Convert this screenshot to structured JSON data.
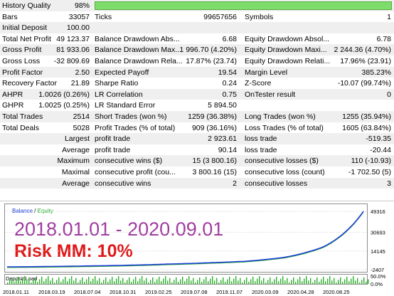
{
  "report": {
    "history_quality": {
      "label": "History Quality",
      "value": "98%",
      "fraction": 0.98
    },
    "rows3": [
      {
        "c1": "Bars",
        "v1": "33057",
        "c2": "Ticks",
        "v2": "99657656",
        "c3": "Symbols",
        "v3": "1"
      },
      {
        "c1": "Initial Deposit",
        "v1": "100.00",
        "c2": "",
        "v2": "",
        "c3": "",
        "v3": ""
      },
      {
        "c1": "Total Net Profit",
        "v1": "49 123.37",
        "c2": "Balance Drawdown Abs...",
        "v2": "6.68",
        "c3": "Equity Drawdown Absol...",
        "v3": "6.78"
      },
      {
        "c1": "Gross Profit",
        "v1": "81 933.06",
        "c2": "Balance Drawdown Max...",
        "v2": "1 996.70 (4.20%)",
        "c3": "Equity Drawdown Maxi...",
        "v3": "2 244.36 (4.70%)"
      },
      {
        "c1": "Gross Loss",
        "v1": "-32 809.69",
        "c2": "Balance Drawdown Rela...",
        "v2": "17.87% (23.74)",
        "c3": "Equity Drawdown Relati...",
        "v3": "17.96% (23.91)"
      },
      {
        "c1": "Profit Factor",
        "v1": "2.50",
        "c2": "Expected Payoff",
        "v2": "19.54",
        "c3": "Margin Level",
        "v3": "385.23%"
      },
      {
        "c1": "Recovery Factor",
        "v1": "21.89",
        "c2": "Sharpe Ratio",
        "v2": "0.24",
        "c3": "Z-Score",
        "v3": "-10.07 (99.74%)"
      },
      {
        "c1": "AHPR",
        "v1": "1.0026 (0.26%)",
        "c2": "LR Correlation",
        "v2": "0.75",
        "c3": "OnTester result",
        "v3": "0"
      },
      {
        "c1": "GHPR",
        "v1": "1.0025 (0.25%)",
        "c2": "LR Standard Error",
        "v2": "5 894.50",
        "c3": "",
        "v3": ""
      },
      {
        "c1": "Total Trades",
        "v1": "2514",
        "c2": "Short Trades (won %)",
        "v2": "1259 (36.38%)",
        "c3": "Long Trades (won %)",
        "v3": "1255 (35.94%)"
      },
      {
        "c1": "Total Deals",
        "v1": "5028",
        "c2": "Profit Trades (% of total)",
        "v2": "909 (36.16%)",
        "c3": "Loss Trades (% of total)",
        "v3": "1605 (63.84%)"
      }
    ],
    "rows_stats": [
      {
        "k": "Largest",
        "c2": "profit trade",
        "v2": "2 923.61",
        "c3": "loss trade",
        "v3": "-519.35"
      },
      {
        "k": "Average",
        "c2": "profit trade",
        "v2": "90.14",
        "c3": "loss trade",
        "v3": "-20.44"
      },
      {
        "k": "Maximum",
        "c2": "consecutive wins ($)",
        "v2": "15 (3 800.16)",
        "c3": "consecutive losses ($)",
        "v3": "110 (-10.93)"
      },
      {
        "k": "Maximal",
        "c2": "consecutive profit (cou...",
        "v2": "3 800.16 (15)",
        "c3": "consecutive loss (count)",
        "v3": "-1 702.50 (5)"
      },
      {
        "k": "Average",
        "c2": "consecutive wins",
        "v2": "2",
        "c3": "consecutive losses",
        "v3": "3"
      }
    ]
  },
  "chart": {
    "legend_balance": "Balance",
    "legend_sep": " / ",
    "legend_equity": "Equity",
    "overlay_period": "2018.01.01 - 2020.09.01",
    "overlay_risk": "Risk MM: 10%",
    "deposit_load_label": "Deposit Load",
    "y_labels": [
      "49316",
      "30693",
      "14145",
      "-2407"
    ],
    "dl_y_labels": [
      "50.0%",
      "0.0%"
    ],
    "x_labels": [
      "2018.01.11",
      "2018.03.19",
      "2018.07.04",
      "2018.10.31",
      "2019.02.25",
      "2019.07.08",
      "2019.11.07",
      "2020.03.09",
      "2020.04.28",
      "2020.08.25"
    ],
    "colors": {
      "balance": "#1f3fd8",
      "equity": "#2ab02a",
      "deposit": "#2ab02a",
      "period": "#a03ca0",
      "risk": "#e01818"
    }
  },
  "chart_data": {
    "type": "line",
    "title": "",
    "xlabel": "",
    "ylabel": "",
    "x": [
      "2018.01.11",
      "2018.03.19",
      "2018.07.04",
      "2018.10.31",
      "2019.02.25",
      "2019.07.08",
      "2019.11.07",
      "2020.03.09",
      "2020.04.28",
      "2020.08.25"
    ],
    "ylim": [
      -2407,
      49316
    ],
    "series": [
      {
        "name": "Balance",
        "values": [
          100,
          400,
          900,
          1500,
          2500,
          3600,
          5000,
          8500,
          18000,
          49223
        ]
      },
      {
        "name": "Equity",
        "values": [
          100,
          400,
          900,
          1500,
          2500,
          3600,
          5000,
          8500,
          18000,
          49223
        ]
      }
    ]
  }
}
